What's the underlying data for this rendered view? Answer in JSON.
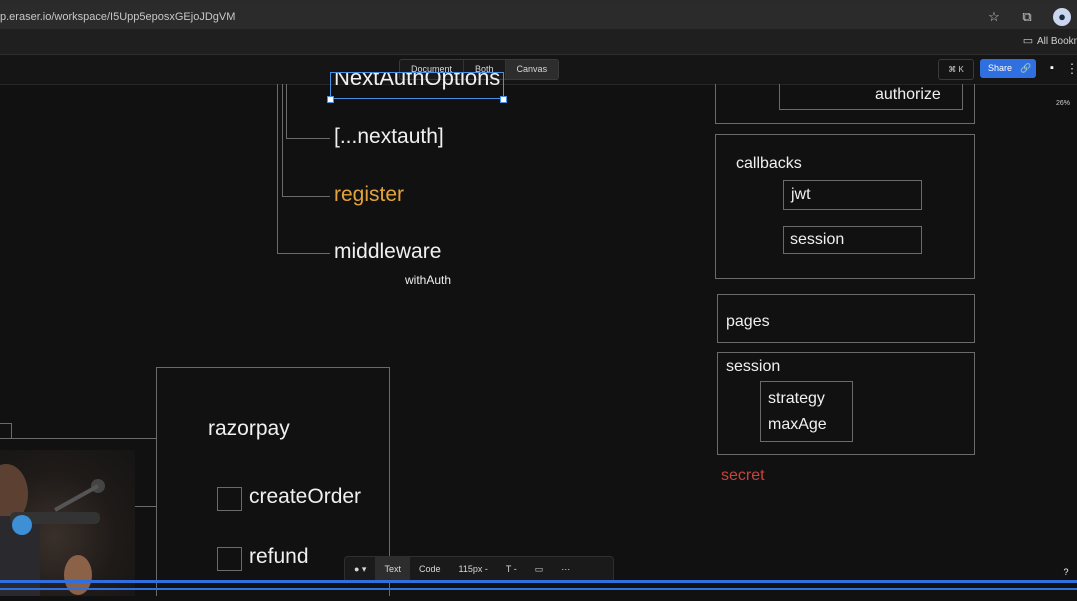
{
  "browser": {
    "url": "p.eraser.io/workspace/I5Upp5eposxGEjoJDgVM",
    "bookmarks_label": "All Bookma"
  },
  "toolbar": {
    "view_tabs": [
      "Document",
      "Both",
      "Canvas"
    ],
    "active_view": "Canvas",
    "shortcut_label": "⌘ K",
    "share_label": "Share",
    "zoom": "26%"
  },
  "canvas": {
    "tree_items": {
      "top": "NextAuthOptions",
      "nextauth": "[...nextauth]",
      "register": "register",
      "middleware": "middleware",
      "middleware_note": "withAuth"
    },
    "right_boxes": {
      "authorize": "authorize",
      "callbacks": "callbacks",
      "jwt": "jwt",
      "session_cb": "session",
      "pages": "pages",
      "session": "session",
      "strategy": "strategy",
      "maxAge": "maxAge",
      "secret": "secret"
    },
    "razorpay": {
      "title": "razorpay",
      "items": [
        "createOrder",
        "refund"
      ]
    },
    "colors": {
      "register": "#e2a33c",
      "secret": "#c9433c",
      "selection": "#4a90e2"
    }
  },
  "bottom_toolbar": {
    "text_tab": "Text",
    "code_tab": "Code",
    "font_size": "115px -",
    "text_style": "T -"
  },
  "help_label": "?"
}
